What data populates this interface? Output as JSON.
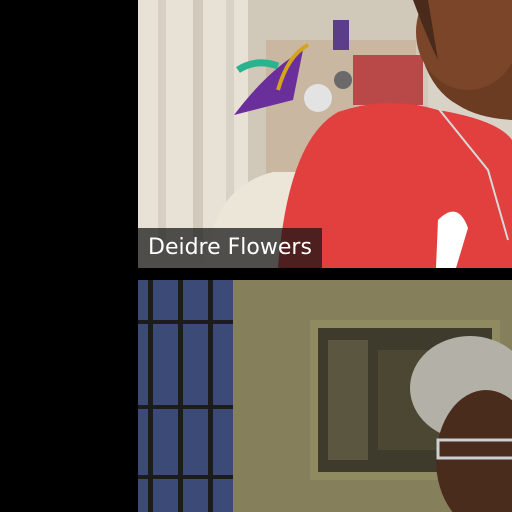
{
  "participants": [
    {
      "name": "Deidre Flowers",
      "video_icon": "participant-video"
    },
    {
      "name": "",
      "video_icon": "participant-video"
    }
  ],
  "colors": {
    "background": "#000000",
    "label_bg": "#141414",
    "shirt": "#e63b3b"
  }
}
